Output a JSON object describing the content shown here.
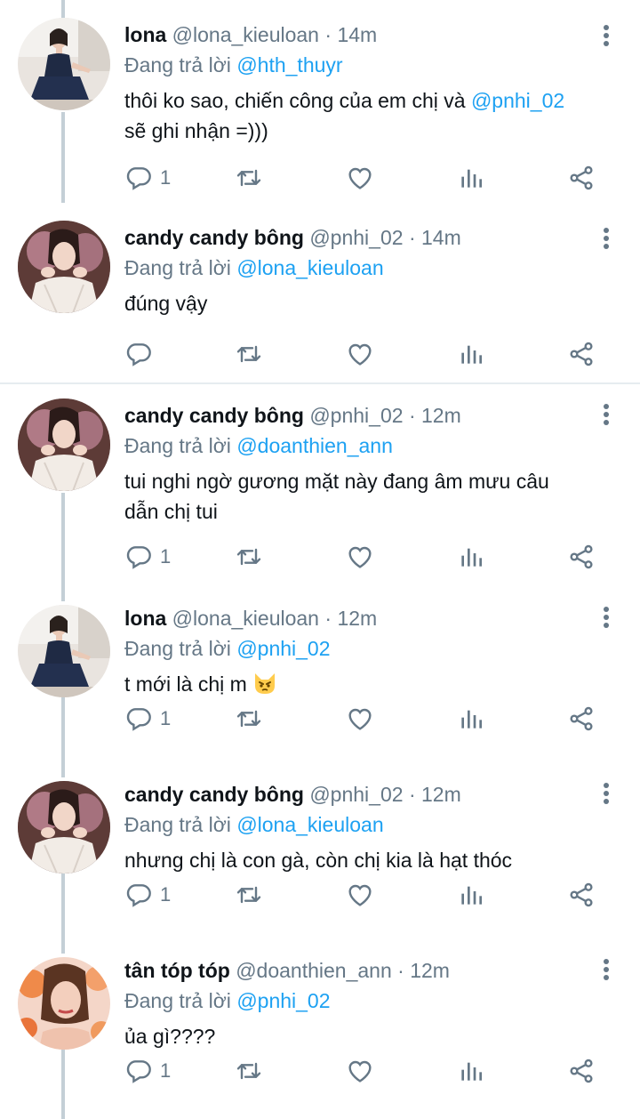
{
  "tweets": [
    {
      "name": "lona",
      "handle": "@lona_kieuloan",
      "time": "14m",
      "reply_prefix": "Đang trả lời",
      "reply_to": "@hth_thuyr",
      "text_before": "thôi ko sao, chiến công của em chị và ",
      "text_mention": "@pnhi_02",
      "text_after": "sẽ ghi nhận =)))",
      "reply_count": "1",
      "avatar": "lona"
    },
    {
      "name": "candy candy bông",
      "handle": "@pnhi_02",
      "time": "14m",
      "reply_prefix": "Đang trả lời",
      "reply_to": "@lona_kieuloan",
      "text": "đúng vậy",
      "reply_count": "",
      "avatar": "candy"
    },
    {
      "name": "candy candy bông",
      "handle": "@pnhi_02",
      "time": "12m",
      "reply_prefix": "Đang trả lời",
      "reply_to": "@doanthien_ann",
      "text": "tui nghi ngờ gương mặt này đang âm mưu câu dẫn chị tui",
      "reply_count": "1",
      "avatar": "candy"
    },
    {
      "name": "lona",
      "handle": "@lona_kieuloan",
      "time": "12m",
      "reply_prefix": "Đang trả lời",
      "reply_to": "@pnhi_02",
      "text": "t mới là chị m",
      "reply_count": "1",
      "avatar": "lona",
      "emoji": "pouting-cat-emoji"
    },
    {
      "name": "candy candy bông",
      "handle": "@pnhi_02",
      "time": "12m",
      "reply_prefix": "Đang trả lời",
      "reply_to": "@lona_kieuloan",
      "text": "nhưng chị là con gà, còn chị kia là hạt thóc",
      "reply_count": "1",
      "avatar": "candy"
    },
    {
      "name": "tân tóp tóp",
      "handle": "@doanthien_ann",
      "time": "12m",
      "reply_prefix": "Đang trả lời",
      "reply_to": "@pnhi_02",
      "text": "ủa gì????",
      "reply_count": "1",
      "avatar": "tan"
    }
  ],
  "separator": "·",
  "icons": [
    "reply-icon",
    "retweet-icon",
    "like-icon",
    "analytics-icon",
    "share-icon",
    "more-options-icon"
  ],
  "colors": {
    "link": "#1da1f2",
    "muted": "#657786",
    "text": "#0f1419",
    "thread_line": "#c4cfd6"
  }
}
